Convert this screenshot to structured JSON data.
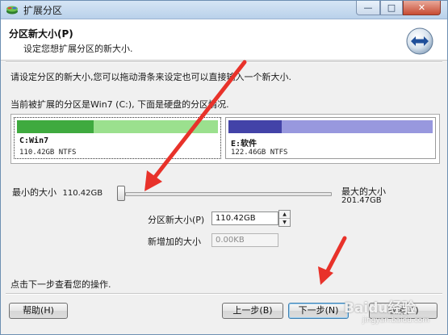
{
  "window": {
    "title": "扩展分区",
    "min_symbol": "—",
    "max_symbol": "□",
    "close_symbol": "✕",
    "app_icon": "disk-icon"
  },
  "header": {
    "title": "分区新大小(P)",
    "subtitle": "设定您想扩展分区的新大小.",
    "icon": "double-arrow-icon"
  },
  "intro_text": "请设定分区的新大小,您可以拖动滑条来设定也可以直接输入一个新大小.",
  "partition_info_text": "当前被扩展的分区是Win7 (C:), 下面是硬盘的分区情况.",
  "disk_map": {
    "partitions": [
      {
        "name": "C:Win7",
        "size": "110.42GB NTFS",
        "used_fraction": 0.38,
        "used_color": "#3faa3f",
        "free_color": "#9be08e",
        "selected": true
      },
      {
        "name": "E:软件",
        "size": "122.46GB NTFS",
        "used_fraction": 0.26,
        "used_color": "#4343a8",
        "free_color": "#9898de",
        "selected": false
      }
    ]
  },
  "slider": {
    "min_label": "最小的大小",
    "min_value": "110.42GB",
    "max_label": "最大的大小",
    "max_value": "201.47GB",
    "position": 0
  },
  "new_size": {
    "label": "分区新大小(P)",
    "value": "110.42GB"
  },
  "added_size": {
    "label": "新增加的大小",
    "value": "0.00KB"
  },
  "footer_text": "点击下一步查看您的操作.",
  "buttons": {
    "help": "帮助(H)",
    "back": "上一步(B)",
    "next": "下一步(N)",
    "cancel": "取消(C)"
  },
  "watermark": {
    "brand": "Baidu经验",
    "url": "jingyan.baidu.com"
  },
  "colors": {
    "arrow": "#e8322a",
    "title_bar": "#c8dcf0"
  }
}
